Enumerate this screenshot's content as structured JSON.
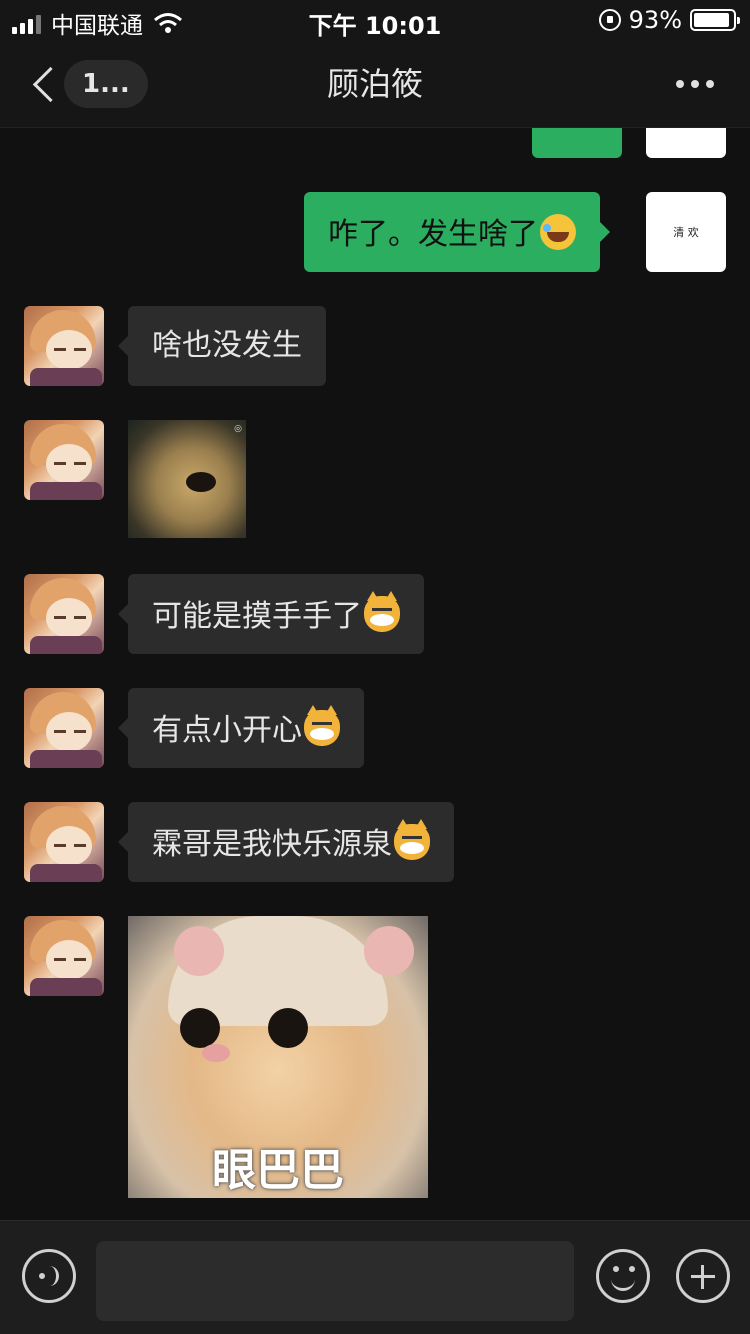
{
  "status_bar": {
    "carrier": "中国联通",
    "time": "下午 10:01",
    "battery": "93%",
    "battery_level": 0.93
  },
  "nav": {
    "back_badge": "1...",
    "title": "顾泊筱",
    "more_icon": "more-dots-icon"
  },
  "me": {
    "avatar_text": "清 欢"
  },
  "messages": [
    {
      "from": "me",
      "text": "咋了。发生啥了",
      "emoji": "laughing-crying-emoji"
    },
    {
      "from": "other",
      "text": "啥也没发生"
    },
    {
      "from": "other",
      "type": "sticker",
      "sticker": "dog-face-sticker"
    },
    {
      "from": "other",
      "text": "可能是摸手手了",
      "emoji": "cat-emoji"
    },
    {
      "from": "other",
      "text": "有点小开心",
      "emoji": "cat-emoji"
    },
    {
      "from": "other",
      "text": "霖哥是我快乐源泉",
      "emoji": "cat-emoji"
    },
    {
      "from": "other",
      "type": "sticker",
      "sticker": "cat-in-hat-sticker",
      "caption": "眼巴巴"
    }
  ],
  "input": {
    "placeholder": ""
  }
}
